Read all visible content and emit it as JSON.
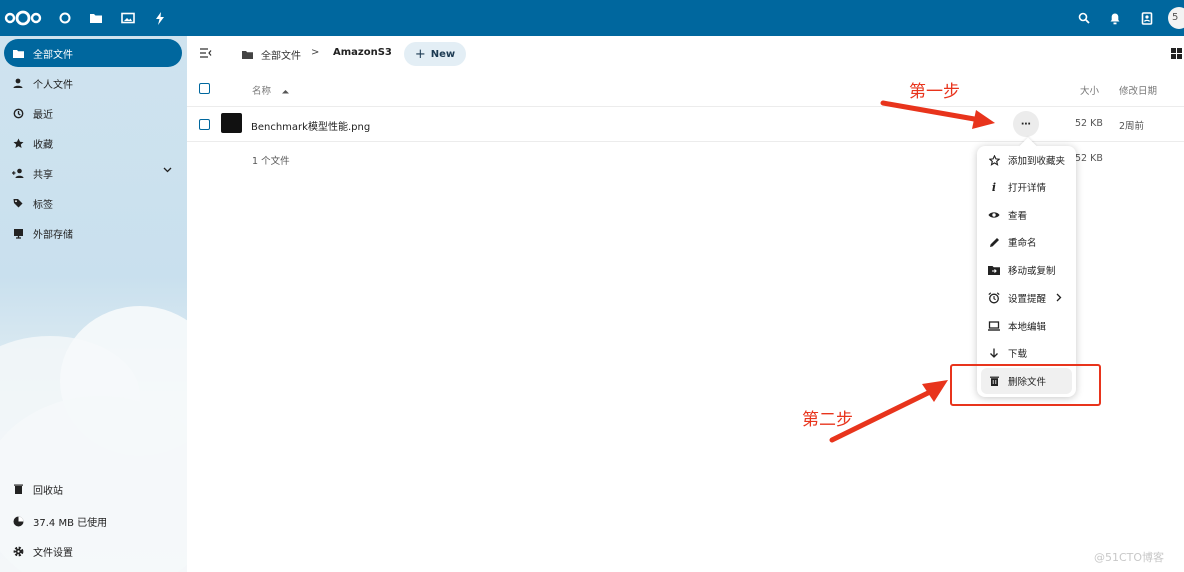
{
  "header": {
    "apps": [
      "files-app-icon",
      "activity-app-icon",
      "photos-app-icon",
      "flash-app-icon"
    ],
    "right_icons": [
      "search-icon",
      "notifications-icon",
      "contacts-icon"
    ],
    "avatar_initial": "5",
    "accent": "#00679e"
  },
  "sidebar": {
    "items": [
      {
        "label": "全部文件",
        "icon": "folder-icon",
        "active": true
      },
      {
        "label": "个人文件",
        "icon": "user-icon"
      },
      {
        "label": "最近",
        "icon": "history-icon"
      },
      {
        "label": "收藏",
        "icon": "star-icon"
      },
      {
        "label": "共享",
        "icon": "share-icon"
      },
      {
        "label": "标签",
        "icon": "tag-icon"
      },
      {
        "label": "外部存储",
        "icon": "external-storage-icon"
      }
    ],
    "bottom": {
      "trash": "回收站",
      "quota": "37.4 MB 已使用",
      "settings": "文件设置"
    }
  },
  "breadcrumb": {
    "root": "全部文件",
    "separator": ">",
    "current": "AmazonS3",
    "new_label": "New",
    "new_plus": "+"
  },
  "table": {
    "headers": {
      "name": "名称",
      "size": "大小",
      "modified": "修改日期"
    },
    "rows": [
      {
        "name": "Benchmark模型性能.png",
        "size": "52 KB",
        "modified": "2周前"
      }
    ],
    "summary": {
      "count": "1 个文件",
      "size": "52 KB"
    }
  },
  "context_menu": {
    "items": [
      {
        "label": "添加到收藏夹",
        "icon": "star-outline-icon"
      },
      {
        "label": "打开详情",
        "icon": "info-icon"
      },
      {
        "label": "查看",
        "icon": "eye-icon"
      },
      {
        "label": "重命名",
        "icon": "pencil-icon"
      },
      {
        "label": "移动或复制",
        "icon": "folder-move-icon"
      },
      {
        "label": "设置提醒",
        "icon": "alarm-icon",
        "submenu": true
      },
      {
        "label": "本地编辑",
        "icon": "laptop-icon"
      },
      {
        "label": "下载",
        "icon": "download-icon"
      },
      {
        "label": "删除文件",
        "icon": "trash-icon"
      }
    ],
    "info_glyph": "i",
    "more_glyph": "⋯"
  },
  "annotations": {
    "step1": "第一步",
    "step2": "第二步",
    "color": "#e8341c"
  },
  "watermark": "@51CTO博客"
}
